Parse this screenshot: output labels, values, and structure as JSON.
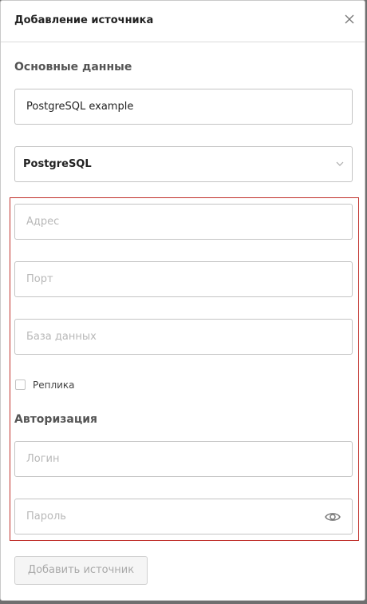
{
  "dialog": {
    "title": "Добавление источника",
    "close_icon": "close-icon"
  },
  "main_section": {
    "title": "Основные данные",
    "name_field": {
      "value": "PostgreSQL example",
      "placeholder": ""
    },
    "type_select": {
      "value": "PostgreSQL",
      "icon": "chevron-down-icon"
    }
  },
  "connection": {
    "address": {
      "placeholder": "Адрес",
      "value": ""
    },
    "port": {
      "placeholder": "Порт",
      "value": ""
    },
    "database": {
      "placeholder": "База данных",
      "value": ""
    },
    "replica_checkbox": {
      "label": "Реплика",
      "checked": false
    }
  },
  "auth_section": {
    "title": "Авторизация",
    "login": {
      "placeholder": "Логин",
      "value": ""
    },
    "password": {
      "placeholder": "Пароль",
      "value": "",
      "icon": "eye-icon"
    }
  },
  "actions": {
    "submit_label": "Добавить источник",
    "submit_disabled": true
  },
  "colors": {
    "highlight_border": "#c0302b",
    "field_border": "#c4c4c4",
    "placeholder": "#b8b8b8",
    "disabled_text": "#a9a9a9"
  }
}
